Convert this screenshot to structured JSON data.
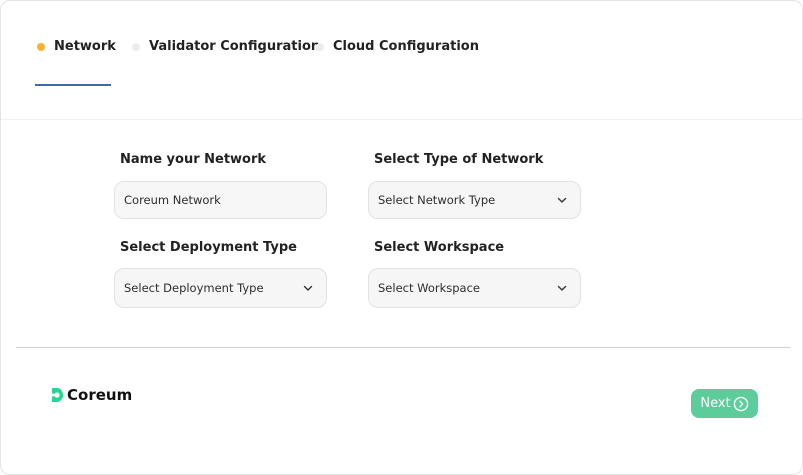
{
  "tabs": [
    {
      "label": "Network",
      "dot_color": "#f5b335"
    },
    {
      "label": "Validator Configuration",
      "dot_color": "#ececec"
    },
    {
      "label": "Cloud Configuration",
      "dot_color": "#ececec"
    }
  ],
  "form": {
    "network_name": {
      "label": "Name your Network",
      "value": "Coreum Network"
    },
    "network_type": {
      "label": "Select Type of Network",
      "selected": "Select Network Type"
    },
    "deployment_type": {
      "label": "Select Deployment Type",
      "selected": "Select Deployment Type"
    },
    "workspace": {
      "label": "Select Workspace",
      "selected": "Select Workspace"
    }
  },
  "footer": {
    "logo_text": "Coreum",
    "logo_color": "#25d695",
    "next_label": "Next",
    "next_color": "#5ccc9b",
    "next_icon": "chevron-right-circle-icon"
  },
  "colors": {
    "active_tab_underline": "#3f6ba6"
  }
}
